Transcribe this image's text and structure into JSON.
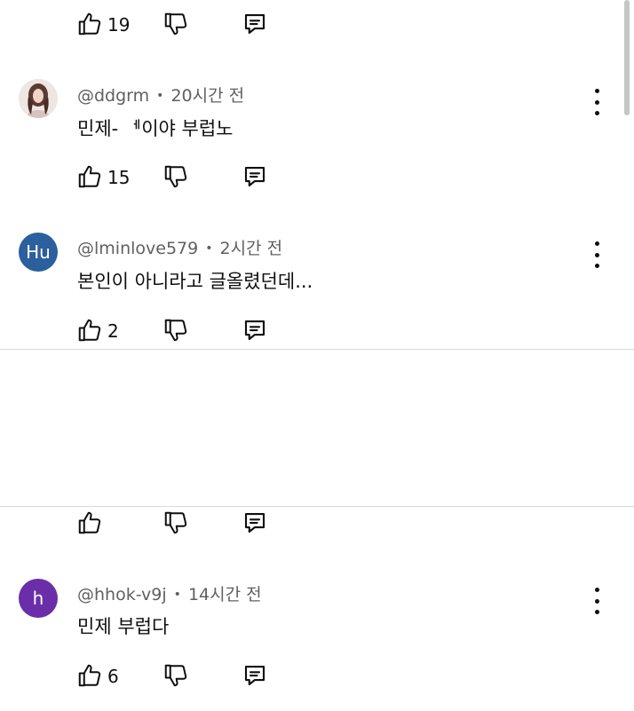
{
  "partial_top": {
    "like_count": "19"
  },
  "comments": [
    {
      "handle": "@ddgrm",
      "time": "20시간 전",
      "text": "민제- ᅦ이야 부럽노",
      "like_count": "15",
      "avatar_letter": ""
    },
    {
      "handle": "@lminlove579",
      "time": "2시간 전",
      "text": "본인이 아니라고 글올렸던데...",
      "like_count": "2",
      "avatar_letter": "Hu",
      "avatar_color": "#2b5f9e"
    },
    {
      "handle": "@hhok-v9j",
      "time": "14시간 전",
      "text": "민제 부럽다",
      "like_count": "6",
      "avatar_letter": "h",
      "avatar_color": "#6a2ea8"
    }
  ],
  "partial_after_gap": {
    "like_count": ""
  },
  "meta_separator": "•",
  "icons": {
    "like": "thumb-up-icon",
    "dislike": "thumb-down-icon",
    "reply": "reply-icon",
    "more": "more-vert-icon"
  }
}
